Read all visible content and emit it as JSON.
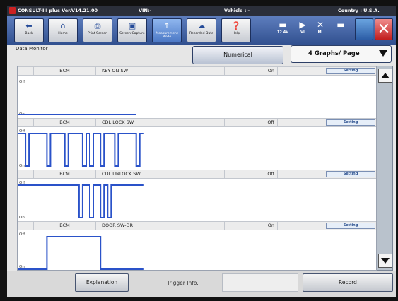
{
  "window": {
    "app_title": "CONSULT-III plus Ver.V14.21.00",
    "vin_label": "VIN:-",
    "vehicle_label": "Vehicle : -",
    "country_label": "Country : U.S.A."
  },
  "toolbar": {
    "buttons": [
      {
        "label": "Back",
        "icon": "back-arrow-icon"
      },
      {
        "label": "Home",
        "icon": "home-icon"
      },
      {
        "label": "Print Screen",
        "icon": "printer-icon"
      },
      {
        "label": "Screen Capture",
        "icon": "camera-icon"
      },
      {
        "label": "Measurement Mode",
        "icon": "measurement-icon"
      },
      {
        "label": "Recorded Data",
        "icon": "recorded-data-icon"
      },
      {
        "label": "Help",
        "icon": "help-icon"
      }
    ],
    "status": [
      {
        "label": "12.4V",
        "icon": "car-battery-icon"
      },
      {
        "label": "VI",
        "icon": "vi-icon"
      },
      {
        "label": "MI",
        "icon": "mi-icon"
      }
    ]
  },
  "header": {
    "data_monitor": "Data Monitor",
    "numerical": "Numerical",
    "graphs_option": "4 Graphs/ Page"
  },
  "graphs": [
    {
      "unit": "BCM",
      "item": "KEY ON SW",
      "value": "On",
      "setting": "Setting",
      "y_top": "Off",
      "y_bottom": "On",
      "segments": [
        [
          0.0,
          0.33,
          0.33,
          1
        ]
      ],
      "trace": [
        [
          0,
          1
        ],
        [
          0.33,
          1
        ]
      ]
    },
    {
      "unit": "BCM",
      "item": "CDL LOCK SW",
      "value": "Off",
      "setting": "Setting",
      "y_top": "Off",
      "y_bottom": "On",
      "trace": [
        [
          0,
          0
        ],
        [
          0.02,
          0
        ],
        [
          0.02,
          1
        ],
        [
          0.03,
          1
        ],
        [
          0.03,
          0
        ],
        [
          0.08,
          0
        ],
        [
          0.08,
          1
        ],
        [
          0.09,
          1
        ],
        [
          0.09,
          0
        ],
        [
          0.13,
          0
        ],
        [
          0.13,
          1
        ],
        [
          0.14,
          1
        ],
        [
          0.14,
          0
        ],
        [
          0.18,
          0
        ],
        [
          0.18,
          1
        ],
        [
          0.19,
          1
        ],
        [
          0.19,
          0
        ],
        [
          0.2,
          0
        ],
        [
          0.2,
          1
        ],
        [
          0.21,
          1
        ],
        [
          0.21,
          0
        ],
        [
          0.23,
          0
        ],
        [
          0.23,
          1
        ],
        [
          0.24,
          1
        ],
        [
          0.24,
          0
        ],
        [
          0.27,
          0
        ],
        [
          0.27,
          1
        ],
        [
          0.28,
          1
        ],
        [
          0.28,
          0
        ],
        [
          0.33,
          0
        ],
        [
          0.33,
          1
        ],
        [
          0.34,
          1
        ],
        [
          0.34,
          0
        ],
        [
          0.35,
          0
        ]
      ]
    },
    {
      "unit": "BCM",
      "item": "CDL UNLOCK SW",
      "value": "Off",
      "setting": "Setting",
      "y_top": "Off",
      "y_bottom": "On",
      "trace": [
        [
          0,
          0
        ],
        [
          0.17,
          0
        ],
        [
          0.17,
          1
        ],
        [
          0.18,
          1
        ],
        [
          0.18,
          0
        ],
        [
          0.2,
          0
        ],
        [
          0.2,
          1
        ],
        [
          0.21,
          1
        ],
        [
          0.21,
          0
        ],
        [
          0.23,
          0
        ],
        [
          0.23,
          1
        ],
        [
          0.24,
          1
        ],
        [
          0.24,
          0
        ],
        [
          0.25,
          0
        ],
        [
          0.25,
          1
        ],
        [
          0.26,
          1
        ],
        [
          0.26,
          0
        ],
        [
          0.35,
          0
        ]
      ]
    },
    {
      "unit": "BCM",
      "item": "DOOR SW-DR",
      "value": "On",
      "setting": "Setting",
      "y_top": "Off",
      "y_bottom": "On",
      "trace": [
        [
          0,
          1
        ],
        [
          0.08,
          1
        ],
        [
          0.08,
          0
        ],
        [
          0.23,
          0
        ],
        [
          0.23,
          1
        ],
        [
          0.35,
          1
        ]
      ]
    }
  ],
  "bottom": {
    "explanation": "Explanation",
    "trigger_info": "Trigger Info.",
    "record": "Record"
  },
  "colors": {
    "toolbar": "#31508f",
    "trace": "#2a52c9",
    "close": "#c21d1d"
  }
}
